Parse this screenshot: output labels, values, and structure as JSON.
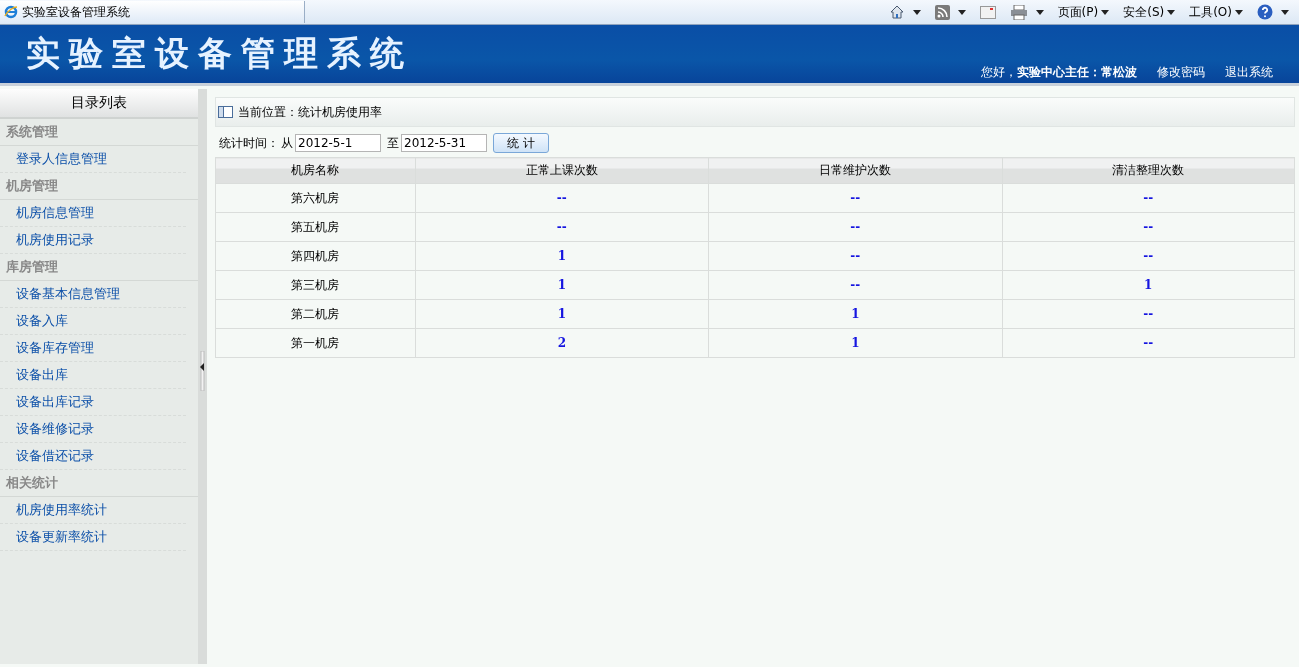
{
  "browser": {
    "tab_title": "实验室设备管理系统",
    "toolbar": [
      {
        "kind": "home"
      },
      {
        "kind": "feed"
      },
      {
        "kind": "mail"
      },
      {
        "kind": "print"
      },
      {
        "kind": "menu",
        "label": "页面(P)"
      },
      {
        "kind": "menu",
        "label": "安全(S)"
      },
      {
        "kind": "menu",
        "label": "工具(O)"
      },
      {
        "kind": "help"
      }
    ]
  },
  "header": {
    "title": "实验室设备管理系统",
    "greeting": "您好，**实验中心主任：常松波**",
    "links": [
      "修改密码",
      "退出系统"
    ]
  },
  "sidebar": {
    "title": "目录列表",
    "groups": [
      {
        "label": "系统管理",
        "items": [
          "登录人信息管理"
        ]
      },
      {
        "label": "机房管理",
        "items": [
          "机房信息管理",
          "机房使用记录"
        ]
      },
      {
        "label": "库房管理",
        "items": [
          "设备基本信息管理",
          "设备入库",
          "设备库存管理",
          "设备出库",
          "设备出库记录",
          "设备维修记录",
          "设备借还记录"
        ]
      },
      {
        "label": "相关统计",
        "items": [
          "机房使用率统计",
          "设备更新率统计"
        ]
      }
    ]
  },
  "breadcrumb": "当前位置：统计机房使用率",
  "filter": {
    "label": "统计时间：",
    "from_label": "从",
    "from": "2012-5-1",
    "to_label": "至",
    "to": "2012-5-31",
    "button": "统 计"
  },
  "table": {
    "columns": [
      "机房名称",
      "正常上课次数",
      "日常维护次数",
      "清洁整理次数"
    ],
    "rows": [
      [
        "第六机房",
        "--",
        "--",
        "--"
      ],
      [
        "第五机房",
        "--",
        "--",
        "--"
      ],
      [
        "第四机房",
        "1",
        "--",
        "--"
      ],
      [
        "第三机房",
        "1",
        "--",
        "1"
      ],
      [
        "第二机房",
        "1",
        "1",
        "--"
      ],
      [
        "第一机房",
        "2",
        "1",
        "--"
      ]
    ]
  }
}
